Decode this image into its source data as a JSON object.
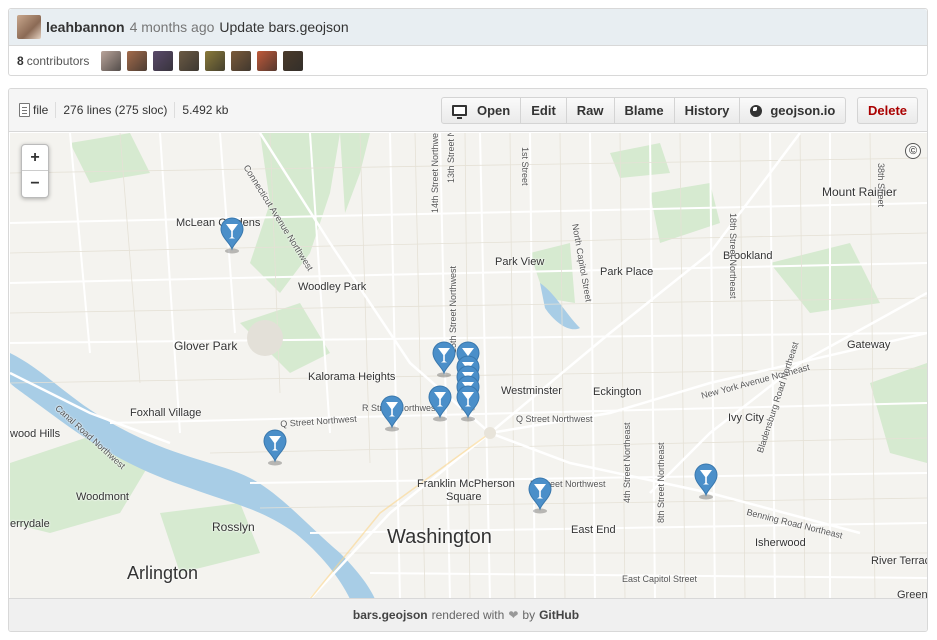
{
  "commit": {
    "author": "leahbannon",
    "time_ago": "4 months ago",
    "message": "Update bars.geojson",
    "contributors_count": "8",
    "contributors_label": "contributors",
    "contributor_avatar_colors": [
      "#b9a49a",
      "#a36b4b",
      "#5a4a6a",
      "#6b5a44",
      "#8a7a3a",
      "#7a5a3a",
      "#c05a3a",
      "#4a3a2a"
    ]
  },
  "file": {
    "type_label": "file",
    "lines": "276 lines (275 sloc)",
    "size": "5.492 kb",
    "buttons": {
      "open": "Open",
      "edit": "Edit",
      "raw": "Raw",
      "blame": "Blame",
      "history": "History",
      "geojson": "geojson.io",
      "delete": "Delete"
    },
    "footer_filename": "bars.geojson",
    "footer_rendered": "rendered with",
    "footer_heart": "❤",
    "footer_by": "by",
    "footer_brand": "GitHub"
  },
  "map": {
    "zoom_in": "+",
    "zoom_out": "−",
    "attribution": "©",
    "marker_color": "#4b8fc9",
    "labels": {
      "mclean_gardens": "McLean Gardens",
      "woodley_park": "Woodley Park",
      "glover_park": "Glover Park",
      "kalorama_heights": "Kalorama Heights",
      "foxhall_village": "Foxhall Village",
      "wood_hills": "wood Hills",
      "woodmont": "Woodmont",
      "rosslyn": "Rosslyn",
      "arlington": "Arlington",
      "washington": "Washington",
      "franklin_mcpherson": "Franklin McPherson",
      "square": "Square",
      "park_view": "Park View",
      "park_place": "Park Place",
      "brookland": "Brookland",
      "mount_rainier": "Mount Rainier",
      "gateway": "Gateway",
      "westminster": "Westminster",
      "eckington": "Eckington",
      "ivy_city": "Ivy City",
      "east_end": "East End",
      "isherwood": "Isherwood",
      "river_terrace": "River Terrac",
      "greenway": "Greenw",
      "cherrydale": "errydale",
      "r_street": "R Street Northwest",
      "q_street": "Q Street Northwest",
      "q_street_east": "Q Street Northwest",
      "k_street": "K Street Northwest",
      "new_york_ave": "New York Avenue Northeast",
      "benning_road": "Benning Road Northeast",
      "east_capitol": "East Capitol Street",
      "canal_road": "Canal Road Northwest",
      "connecticut_ave": "Connecticut Avenue Northwest",
      "fourteenth_st": "14th Street Northwest",
      "thirteenth_st": "13th Street Northwest",
      "north_capitol": "North Capitol Street",
      "eighteenth_st": "18th Street Northeast",
      "thirtyeighth_st": "38th Street",
      "bladensburg": "Bladensburg Road Northeast",
      "fourth_st": "4th Street Northeast",
      "eighth_st": "8th Street Northeast",
      "fifteenth_st": "15th Street Northwest",
      "first_st": "1st Street"
    }
  }
}
